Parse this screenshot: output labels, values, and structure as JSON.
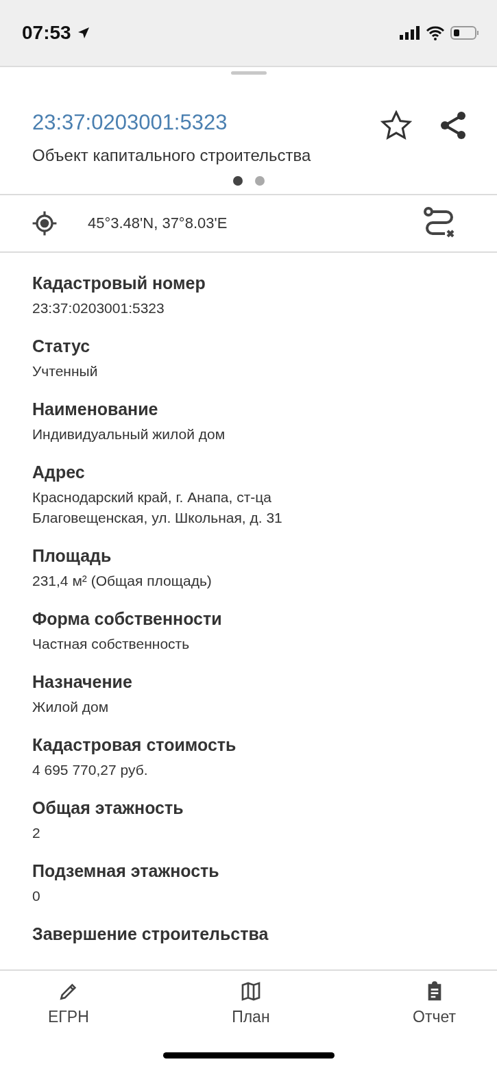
{
  "status_bar": {
    "time": "07:53"
  },
  "header": {
    "title": "23:37:0203001:5323",
    "subtitle": "Объект капитального строительства"
  },
  "pager": [
    {
      "selected": true
    },
    {
      "selected": false
    }
  ],
  "location": {
    "coordinates": "45°3.48'N, 37°8.03'E"
  },
  "fields": [
    {
      "label": "Кадастровый номер",
      "value": "23:37:0203001:5323"
    },
    {
      "label": "Статус",
      "value": "Учтенный"
    },
    {
      "label": "Наименование",
      "value": "Индивидуальный жилой дом"
    },
    {
      "label": "Адрес",
      "value": "Краснодарский край, г. Анапа, ст-ца Благовещенская, ул. Школьная, д. 31"
    },
    {
      "label": "Площадь",
      "value": "231,4 м² (Общая площадь)"
    },
    {
      "label": "Форма собственности",
      "value": "Частная собственность"
    },
    {
      "label": "Назначение",
      "value": "Жилой дом"
    },
    {
      "label": "Кадастровая стоимость",
      "value": "4 695 770,27 руб."
    },
    {
      "label": "Общая этажность",
      "value": "2"
    },
    {
      "label": "Подземная этажность",
      "value": "0"
    },
    {
      "label": "Завершение строительства"
    }
  ],
  "bottom_nav": [
    {
      "kind": "pencil",
      "label": "ЕГРН"
    },
    {
      "kind": "map",
      "label": "План"
    },
    {
      "kind": "clipboard",
      "label": "Отчет"
    }
  ]
}
